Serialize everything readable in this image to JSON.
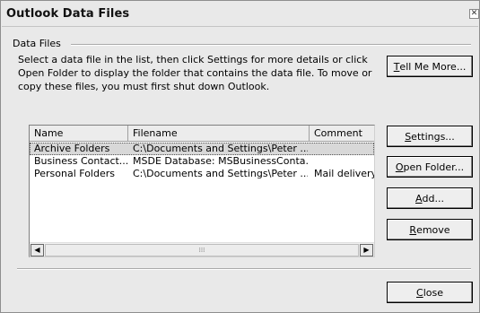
{
  "window": {
    "title": "Outlook Data Files",
    "close_glyph": "✕"
  },
  "group": {
    "label": "Data Files"
  },
  "instructions": "Select a data file in the list, then click Settings for more details or click\nOpen Folder to display the folder that contains the data file. To move or\ncopy these files, you must first shut down Outlook.",
  "buttons": {
    "tell_me_more": {
      "pre": "",
      "key": "T",
      "post": "ell Me More..."
    },
    "settings": {
      "pre": "",
      "key": "S",
      "post": "ettings..."
    },
    "open_folder": {
      "pre": "",
      "key": "O",
      "post": "pen Folder..."
    },
    "add": {
      "pre": "",
      "key": "A",
      "post": "dd..."
    },
    "remove": {
      "pre": "",
      "key": "R",
      "post": "emove"
    },
    "close": {
      "pre": "",
      "key": "C",
      "post": "lose"
    }
  },
  "list": {
    "columns": [
      "Name",
      "Filename",
      "Comment"
    ],
    "rows": [
      {
        "name": "Archive Folders",
        "filename": "C:\\Documents and Settings\\Peter ...",
        "comment": "",
        "selected": true
      },
      {
        "name": "Business Contact...",
        "filename": "MSDE Database: MSBusinessConta...",
        "comment": "",
        "selected": false
      },
      {
        "name": "Personal Folders",
        "filename": "C:\\Documents and Settings\\Peter ...",
        "comment": "Mail delivery",
        "selected": false
      }
    ],
    "scroll_left": "◀",
    "scroll_right": "▶",
    "thumb_grip": "⁞⁞⁞"
  }
}
